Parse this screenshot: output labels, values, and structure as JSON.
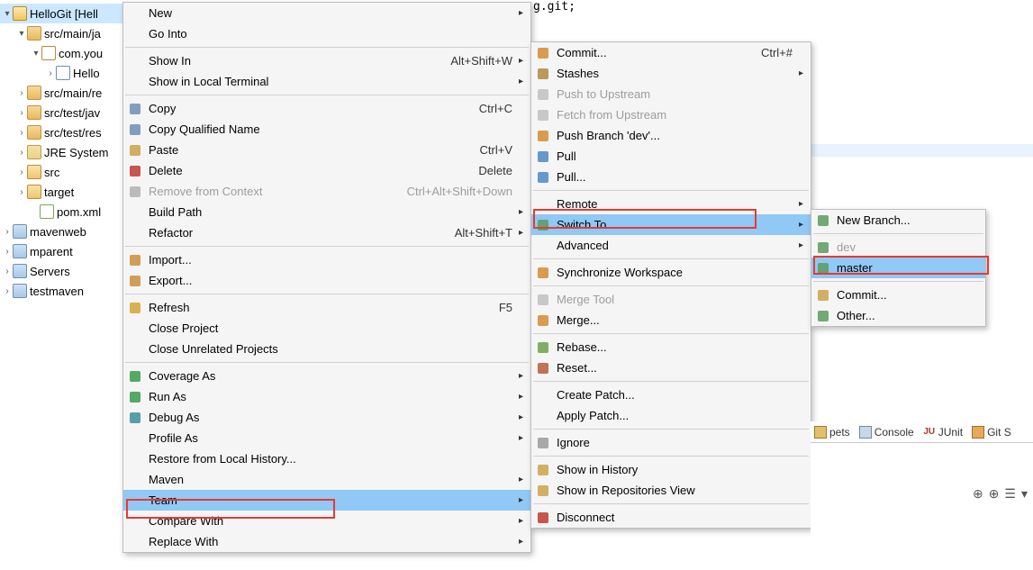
{
  "tree": {
    "root": "HelloGit [Hell",
    "items": [
      "src/main/ja",
      "com.you",
      "Hello",
      "src/main/re",
      "src/test/jav",
      "src/test/res",
      "JRE System",
      "src",
      "target",
      "pom.xml",
      "mavenweb",
      "mparent",
      "Servers",
      "testmaven"
    ]
  },
  "editor": {
    "frag": "g.git;"
  },
  "menu_main": [
    {
      "label": "New",
      "arrow": true
    },
    {
      "label": "Go Into"
    },
    {
      "sep": true
    },
    {
      "label": "Show In",
      "accel": "Alt+Shift+W",
      "arrow": true
    },
    {
      "label": "Show in Local Terminal",
      "arrow": true
    },
    {
      "sep": true
    },
    {
      "label": "Copy",
      "accel": "Ctrl+C",
      "icon": "copy"
    },
    {
      "label": "Copy Qualified Name",
      "icon": "copyq"
    },
    {
      "label": "Paste",
      "accel": "Ctrl+V",
      "icon": "paste"
    },
    {
      "label": "Delete",
      "accel": "Delete",
      "icon": "delete"
    },
    {
      "label": "Remove from Context",
      "accel": "Ctrl+Alt+Shift+Down",
      "icon": "remove",
      "disabled": true
    },
    {
      "label": "Build Path",
      "arrow": true
    },
    {
      "label": "Refactor",
      "accel": "Alt+Shift+T",
      "arrow": true
    },
    {
      "sep": true
    },
    {
      "label": "Import...",
      "icon": "import"
    },
    {
      "label": "Export...",
      "icon": "export"
    },
    {
      "sep": true
    },
    {
      "label": "Refresh",
      "accel": "F5",
      "icon": "refresh"
    },
    {
      "label": "Close Project"
    },
    {
      "label": "Close Unrelated Projects"
    },
    {
      "sep": true
    },
    {
      "label": "Coverage As",
      "arrow": true,
      "icon": "cov"
    },
    {
      "label": "Run As",
      "arrow": true,
      "icon": "run"
    },
    {
      "label": "Debug As",
      "arrow": true,
      "icon": "debug"
    },
    {
      "label": "Profile As",
      "arrow": true
    },
    {
      "label": "Restore from Local History..."
    },
    {
      "label": "Maven",
      "arrow": true
    },
    {
      "label": "Team",
      "arrow": true,
      "highlight": true
    },
    {
      "label": "Compare With",
      "arrow": true
    },
    {
      "label": "Replace With",
      "arrow": true
    }
  ],
  "menu_team": [
    {
      "label": "Commit...",
      "accel": "Ctrl+#",
      "icon": "commit"
    },
    {
      "label": "Stashes",
      "arrow": true,
      "icon": "stash"
    },
    {
      "label": "Push to Upstream",
      "icon": "pushup",
      "disabled": true
    },
    {
      "label": "Fetch from Upstream",
      "icon": "fetch",
      "disabled": true
    },
    {
      "label": "Push Branch 'dev'...",
      "icon": "pushb"
    },
    {
      "label": "Pull",
      "icon": "pull"
    },
    {
      "label": "Pull...",
      "icon": "pull"
    },
    {
      "sep": true
    },
    {
      "label": "Remote",
      "arrow": true
    },
    {
      "label": "Switch To",
      "arrow": true,
      "highlight": true,
      "icon": "switch"
    },
    {
      "label": "Advanced",
      "arrow": true
    },
    {
      "sep": true
    },
    {
      "label": "Synchronize Workspace",
      "icon": "sync"
    },
    {
      "sep": true
    },
    {
      "label": "Merge Tool",
      "icon": "mtool",
      "disabled": true
    },
    {
      "label": "Merge...",
      "icon": "merge"
    },
    {
      "sep": true
    },
    {
      "label": "Rebase...",
      "icon": "rebase"
    },
    {
      "label": "Reset...",
      "icon": "reset"
    },
    {
      "sep": true
    },
    {
      "label": "Create Patch..."
    },
    {
      "label": "Apply Patch..."
    },
    {
      "sep": true
    },
    {
      "label": "Ignore",
      "icon": "ignore"
    },
    {
      "sep": true
    },
    {
      "label": "Show in History",
      "icon": "hist"
    },
    {
      "label": "Show in Repositories View",
      "icon": "repo"
    },
    {
      "sep": true
    },
    {
      "label": "Disconnect",
      "icon": "disc"
    }
  ],
  "menu_switch": [
    {
      "label": "New Branch...",
      "icon": "newbr"
    },
    {
      "sep": true
    },
    {
      "label": "dev",
      "icon": "branch",
      "disabled": true
    },
    {
      "label": "master",
      "icon": "branch",
      "highlight": true
    },
    {
      "sep": true
    },
    {
      "label": "Commit...",
      "icon": "commitp"
    },
    {
      "label": "Other...",
      "icon": "other"
    }
  ],
  "view_tabs": {
    "snippets": "pets",
    "console": "Console",
    "junit": "JUnit",
    "git": "Git S"
  }
}
